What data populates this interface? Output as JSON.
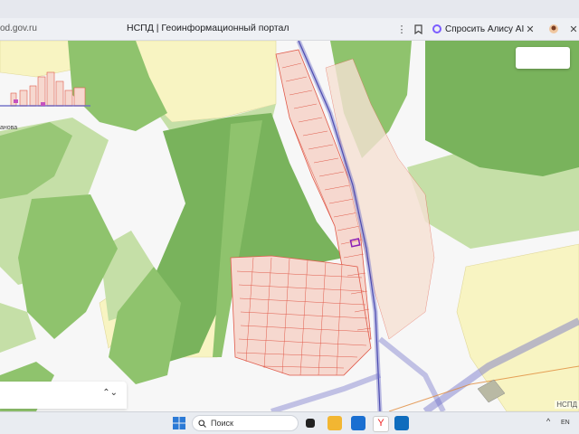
{
  "browser": {
    "url_fragment": "od.gov.ru",
    "tab_title": "НСПД | Геоинформационный портал",
    "alice_label": "Спросить Алису AI"
  },
  "map": {
    "place_label": "анова",
    "watermark": "НСПД",
    "colors": {
      "forest": "#8fc36d",
      "forest_dark": "#79b35c",
      "field": "#f8f4c2",
      "light_green": "#c5dfa7",
      "parcel_fill": "#f6d8cf",
      "parcel_line": "#e05a4a",
      "road": "#6e6ec8",
      "selected": "#8b1fb5"
    }
  },
  "taskbar": {
    "search_label": "Поиск",
    "lang": "EN"
  }
}
